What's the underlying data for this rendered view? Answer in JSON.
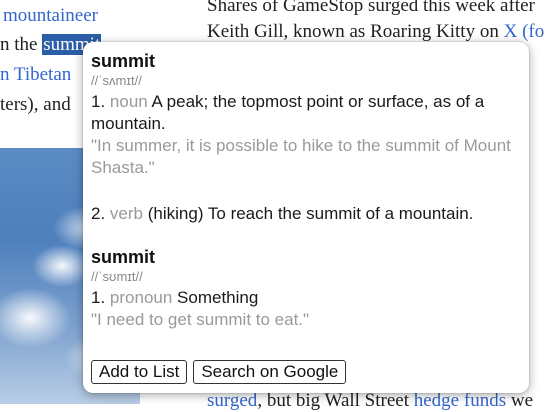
{
  "article": {
    "left_col": {
      "line1": "mountaineer",
      "line2_prefix": "n the",
      "line2_selected": "summit",
      "line3": "n Tibetan",
      "line4": "ters), and"
    },
    "right_col": {
      "line1": "Shares of GameStop surged this week after",
      "line2_prefix": "Keith Gill, known as Roaring Kitty on",
      "line2_link": "X (fo",
      "bottom_link1": "surged",
      "bottom_mid": ", but big Wall Street",
      "bottom_link2": "hedge funds",
      "bottom_suffix": " we"
    }
  },
  "popup": {
    "entries": [
      {
        "word": "summit",
        "pronunciation": "//ˈsʌmɪt//",
        "senses": [
          {
            "number": "1.",
            "part_of_speech": "noun",
            "definition": "A peak; the topmost point or surface, as of a mountain.",
            "example": "\"In summer, it is possible to hike to the summit of Mount Shasta.\""
          },
          {
            "number": "2.",
            "part_of_speech": "verb",
            "definition": "(hiking) To reach the summit of a mountain.",
            "example": ""
          }
        ]
      },
      {
        "word": "summit",
        "pronunciation": "//ˈsʊmɪt//",
        "senses": [
          {
            "number": "1.",
            "part_of_speech": "pronoun",
            "definition": "Something",
            "example": "\"I need to get summit to eat.\""
          }
        ]
      }
    ],
    "buttons": {
      "add_to_list": "Add to List",
      "search_google": "Search on Google"
    }
  }
}
